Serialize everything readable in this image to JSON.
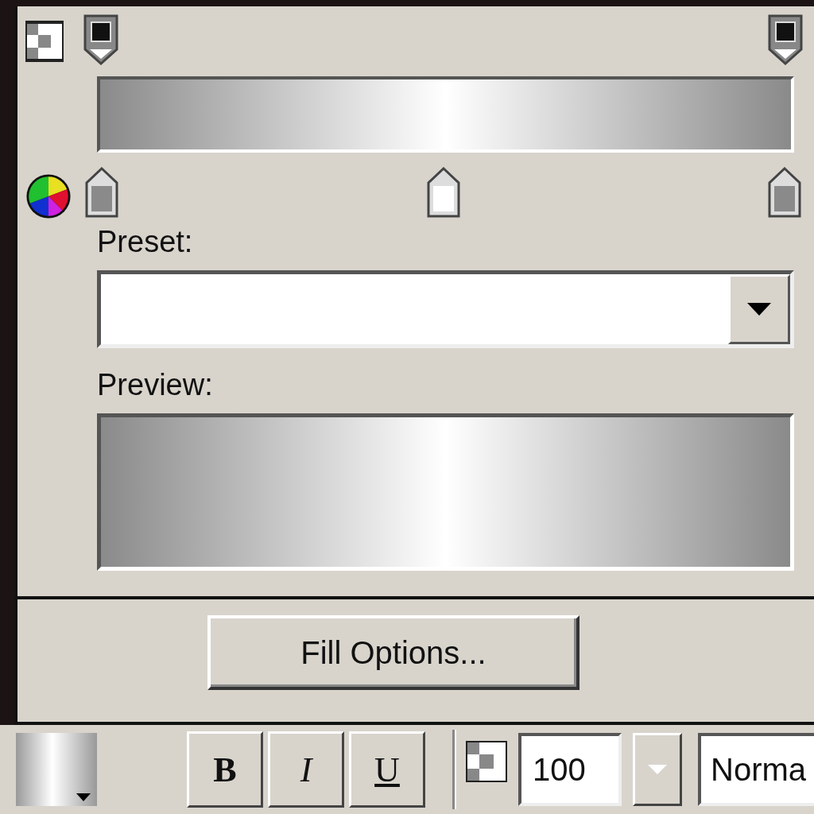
{
  "gradient_editor": {
    "opacity_stops": [
      {
        "kind": "opaque"
      },
      {
        "kind": "opaque"
      }
    ],
    "color_stops": [
      {
        "color": "#8a8a8a"
      },
      {
        "color": "#ffffff"
      },
      {
        "color": "#8a8a8a"
      }
    ],
    "preset_label": "Preset:",
    "preview_label": "Preview:",
    "fill_options_button": "Fill Options..."
  },
  "toolbar": {
    "style_buttons": [
      {
        "kind": "bold",
        "label": "B"
      },
      {
        "kind": "italic",
        "label": "I"
      },
      {
        "kind": "underline",
        "label": "U"
      }
    ],
    "opacity_value": "100",
    "blend_mode": "Norma"
  }
}
